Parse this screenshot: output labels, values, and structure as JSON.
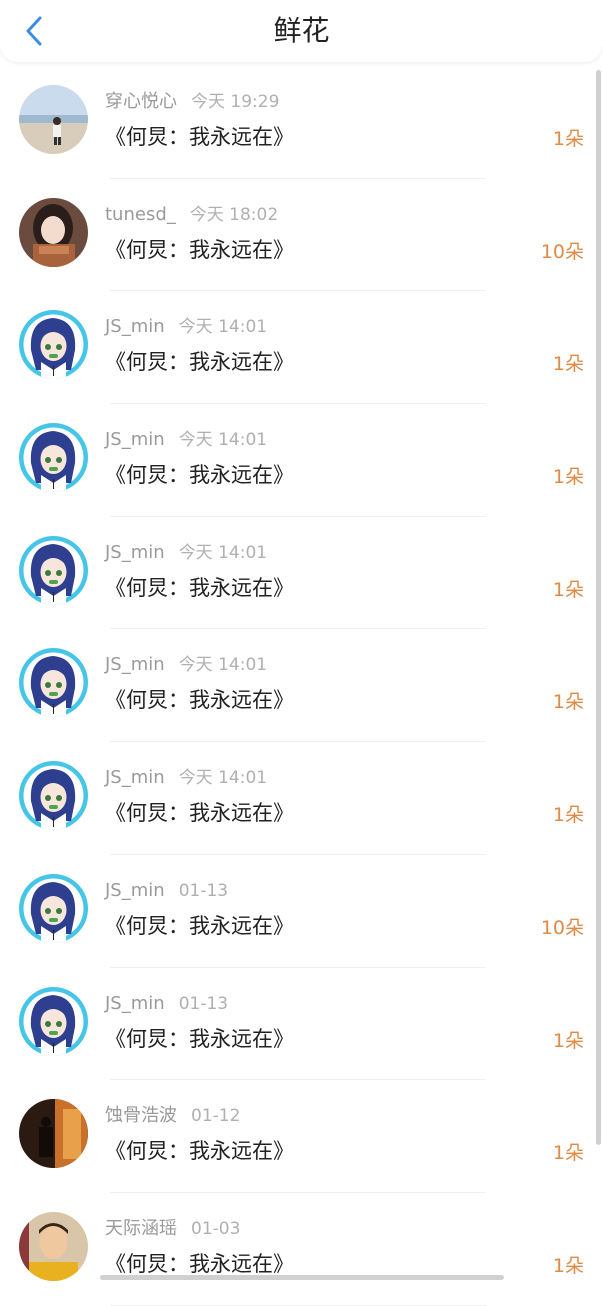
{
  "header": {
    "title": "鲜花"
  },
  "colors": {
    "accent": "#3a8ee6",
    "amount": "#e08a45"
  },
  "items": [
    {
      "user": "穿心悦心",
      "time": "今天 19:29",
      "book": "《何炅：我永远在》",
      "amount": "1朵",
      "avatar": "beach"
    },
    {
      "user": "tunesd_",
      "time": "今天 18:02",
      "book": "《何炅：我永远在》",
      "amount": "10朵",
      "avatar": "girl"
    },
    {
      "user": "JS_min",
      "time": "今天 14:01",
      "book": "《何炅：我永远在》",
      "amount": "1朵",
      "avatar": "anime"
    },
    {
      "user": "JS_min",
      "time": "今天 14:01",
      "book": "《何炅：我永远在》",
      "amount": "1朵",
      "avatar": "anime"
    },
    {
      "user": "JS_min",
      "time": "今天 14:01",
      "book": "《何炅：我永远在》",
      "amount": "1朵",
      "avatar": "anime"
    },
    {
      "user": "JS_min",
      "time": "今天 14:01",
      "book": "《何炅：我永远在》",
      "amount": "1朵",
      "avatar": "anime"
    },
    {
      "user": "JS_min",
      "time": "今天 14:01",
      "book": "《何炅：我永远在》",
      "amount": "1朵",
      "avatar": "anime"
    },
    {
      "user": "JS_min",
      "time": "01-13",
      "book": "《何炅：我永远在》",
      "amount": "10朵",
      "avatar": "anime"
    },
    {
      "user": "JS_min",
      "time": "01-13",
      "book": "《何炅：我永远在》",
      "amount": "1朵",
      "avatar": "anime"
    },
    {
      "user": "蚀骨浩波",
      "time": "01-12",
      "book": "《何炅：我永远在》",
      "amount": "1朵",
      "avatar": "dark"
    },
    {
      "user": "天际涵瑶",
      "time": "01-03",
      "book": "《何炅：我永远在》",
      "amount": "1朵",
      "avatar": "person"
    }
  ]
}
